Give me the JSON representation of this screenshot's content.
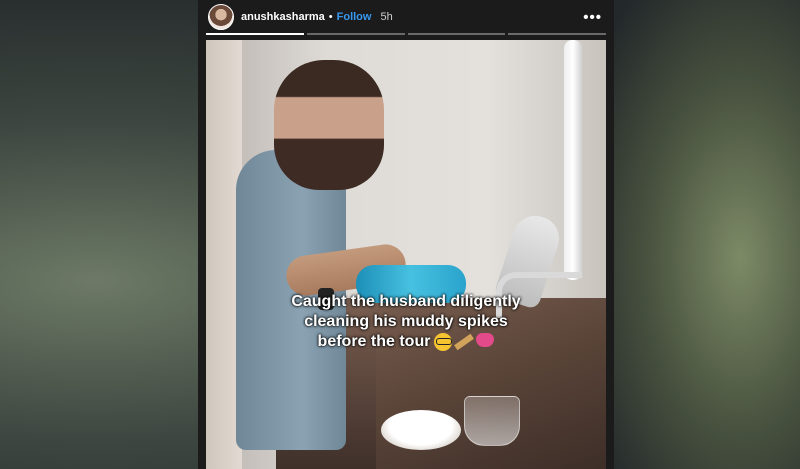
{
  "story": {
    "username": "anushkasharma",
    "separator": "•",
    "follow_label": "Follow",
    "time": "5h",
    "more_label": "•••",
    "progress": {
      "segments": 4,
      "current": 1
    }
  },
  "caption": {
    "line1": "Caught the husband diligently",
    "line2": "cleaning his muddy spikes",
    "line3": "before the tour",
    "emojis": [
      "nerd-face-icon",
      "cricket-bat-icon",
      "pink-heart-icon"
    ]
  },
  "colors": {
    "follow": "#3897f0",
    "header_bg": "#1b1b1b"
  }
}
